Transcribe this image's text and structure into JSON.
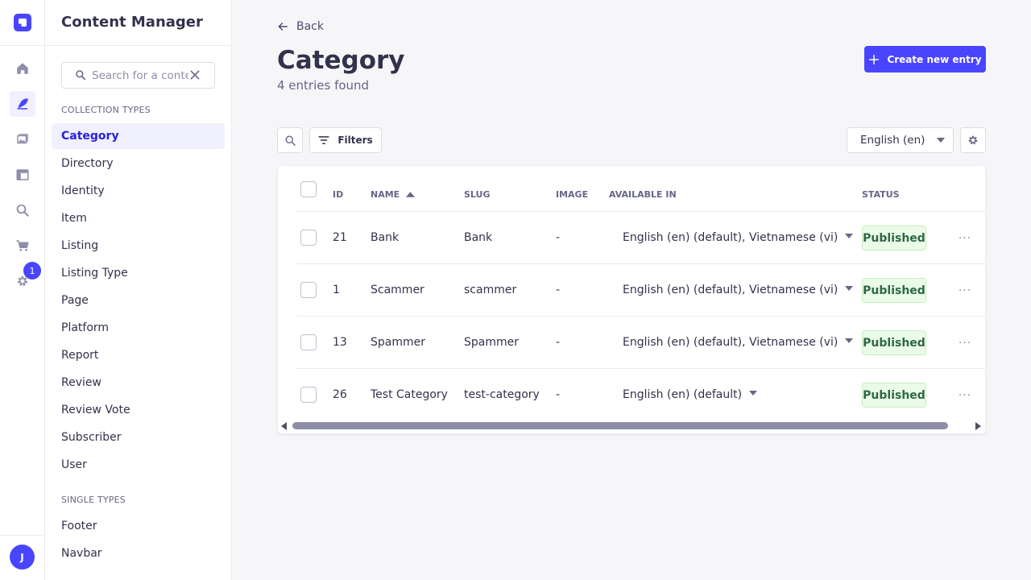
{
  "rail": {
    "icons": [
      "logo-icon",
      "home-icon",
      "feather-icon",
      "media-icon",
      "layout-icon",
      "search-icon",
      "cart-icon",
      "settings-icon"
    ],
    "settings_badge": "1",
    "avatar_initial": "J"
  },
  "subnav": {
    "title": "Content Manager",
    "search_placeholder": "Search for a content type",
    "collection_types_label": "COLLECTION TYPES",
    "collection_types": [
      {
        "label": "Category",
        "active": true
      },
      {
        "label": "Directory"
      },
      {
        "label": "Identity"
      },
      {
        "label": "Item"
      },
      {
        "label": "Listing"
      },
      {
        "label": "Listing Type"
      },
      {
        "label": "Page"
      },
      {
        "label": "Platform"
      },
      {
        "label": "Report"
      },
      {
        "label": "Review"
      },
      {
        "label": "Review Vote"
      },
      {
        "label": "Subscriber"
      },
      {
        "label": "User"
      }
    ],
    "single_types_label": "SINGLE TYPES",
    "single_types": [
      {
        "label": "Footer"
      },
      {
        "label": "Navbar"
      }
    ]
  },
  "header": {
    "back_label": "Back",
    "title": "Category",
    "subtitle": "4 entries found",
    "create_label": "Create new entry"
  },
  "toolbar": {
    "filters_label": "Filters",
    "locale": "English (en)"
  },
  "table": {
    "columns": [
      "ID",
      "NAME",
      "SLUG",
      "IMAGE",
      "AVAILABLE IN",
      "STATUS"
    ],
    "rows": [
      {
        "id": "21",
        "name": "Bank",
        "slug": "Bank",
        "image": "-",
        "available": "English (en) (default), Vietnamese (vi)",
        "status": "Published"
      },
      {
        "id": "1",
        "name": "Scammer",
        "slug": "scammer",
        "image": "-",
        "available": "English (en) (default), Vietnamese (vi)",
        "status": "Published"
      },
      {
        "id": "13",
        "name": "Spammer",
        "slug": "Spammer",
        "image": "-",
        "available": "English (en) (default), Vietnamese (vi)",
        "status": "Published"
      },
      {
        "id": "26",
        "name": "Test Category",
        "slug": "test-category",
        "image": "-",
        "available": "English (en) (default)",
        "status": "Published"
      }
    ]
  },
  "colors": {
    "primary": "#4945ff",
    "published_bg": "#eafbe7",
    "published_text": "#2f6846"
  }
}
